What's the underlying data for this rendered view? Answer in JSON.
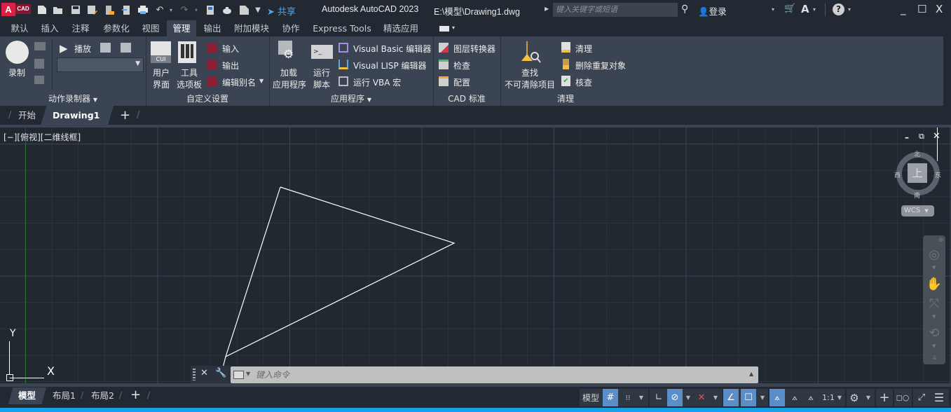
{
  "app": {
    "title": "Autodesk AutoCAD 2023",
    "file_path": "E:\\模型\\Drawing1.dwg",
    "logo_letter": "A",
    "logo_text": "CAD",
    "share_label": "共享",
    "search_placeholder": "键入关键字或短语",
    "login_label": "登录",
    "quick_access": [
      "new-icon",
      "open-icon",
      "save-icon",
      "save-as-icon",
      "open-from-mobile-icon",
      "save-to-mobile-icon",
      "plot-icon",
      "undo-icon",
      "redo-icon",
      "properties-icon",
      "teapot-icon",
      "sheet-icon",
      "customize-icon"
    ],
    "window_controls": {
      "minimize": "_",
      "maximize": "☐",
      "close": "X"
    }
  },
  "ribbon_tabs": [
    {
      "label": "默认",
      "active": false
    },
    {
      "label": "插入",
      "active": false
    },
    {
      "label": "注释",
      "active": false
    },
    {
      "label": "参数化",
      "active": false
    },
    {
      "label": "视图",
      "active": false
    },
    {
      "label": "管理",
      "active": true
    },
    {
      "label": "输出",
      "active": false
    },
    {
      "label": "附加模块",
      "active": false
    },
    {
      "label": "协作",
      "active": false
    },
    {
      "label": "Express Tools",
      "active": false
    },
    {
      "label": "精选应用",
      "active": false
    }
  ],
  "ribbon": {
    "action_recorder": {
      "title": "动作录制器",
      "record_label": "录制",
      "play_label": "播放",
      "dropdown_value": ""
    },
    "customization": {
      "title": "自定义设置",
      "ui_label_1": "用户",
      "ui_label_2": "界面",
      "cui_badge": "CUI",
      "tool_palettes_1": "工具",
      "tool_palettes_2": "选项板",
      "import_label": "输入",
      "export_label": "输出",
      "edit_aliases_label": "编辑别名"
    },
    "applications": {
      "title": "应用程序",
      "load_app_1": "加载",
      "load_app_2": "应用程序",
      "run_script_1": "运行",
      "run_script_2": "脚本",
      "vba_editor": "Visual Basic 编辑器",
      "lisp_editor": "Visual LISP 编辑器",
      "run_vba": "运行 VBA 宏"
    },
    "cad_standards": {
      "title": "CAD 标准",
      "layer_translator": "图层转换器",
      "check": "检查",
      "configure": "配置"
    },
    "cleanup": {
      "title": "清理",
      "find_1": "查找",
      "find_2": "不可清除项目",
      "purge": "清理",
      "overkill": "删除重复对象",
      "audit": "核查"
    }
  },
  "doc_tabs": [
    {
      "label": "开始",
      "active": false
    },
    {
      "label": "Drawing1",
      "active": true,
      "closable": true
    }
  ],
  "viewport": {
    "label": "[−][俯视][二维线框]",
    "ucs_x": "X",
    "ucs_y": "Y",
    "drawing": {
      "entity": "triangle",
      "color": "#ffffff"
    }
  },
  "viewcube": {
    "face": "上",
    "north": "北",
    "south": "南",
    "east": "东",
    "west": "西",
    "wcs_label": "WCS"
  },
  "command_line": {
    "placeholder": "键入命令"
  },
  "layout_tabs": [
    {
      "label": "模型",
      "active": true
    },
    {
      "label": "布局1",
      "active": false
    },
    {
      "label": "布局2",
      "active": false
    }
  ],
  "status_bar": {
    "model_label": "模型",
    "annotation_scale": "1:1",
    "toggles": [
      {
        "name": "grid",
        "on": true
      },
      {
        "name": "snap",
        "on": false
      },
      {
        "name": "ortho",
        "on": false
      },
      {
        "name": "polar",
        "on": true
      },
      {
        "name": "isodraft",
        "on": false
      },
      {
        "name": "object-snap-tracking",
        "on": true
      },
      {
        "name": "object-snap",
        "on": true
      },
      {
        "name": "annotation-visibility",
        "on": true
      }
    ]
  },
  "colors": {
    "accent_blue": "#5b8dc8",
    "share_blue": "#4ea4e8",
    "logo_red": "#d82145",
    "background": "#212830",
    "panel": "#3b4453"
  }
}
